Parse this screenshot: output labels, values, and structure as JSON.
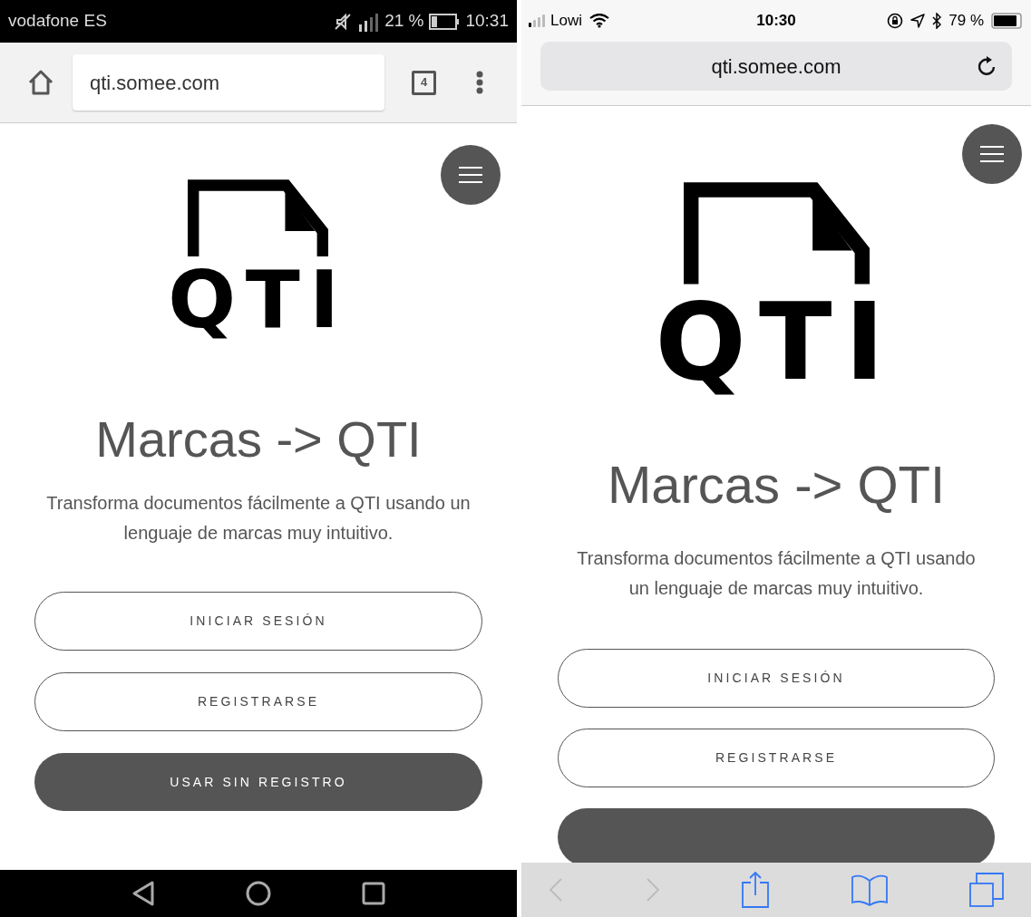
{
  "phones": [
    {
      "kind": "android",
      "status_bar": {
        "carrier": "vodafone ES",
        "battery": "21 %",
        "time": "10:31"
      },
      "address_bar": {
        "url": "qti.somee.com",
        "tab_count": "4"
      },
      "page": {
        "logo_text": "QTI",
        "title": "Marcas -> QTI",
        "description": "Transforma documentos fácilmente a QTI usando un lenguaje de marcas muy intuitivo."
      },
      "buttons": [
        {
          "kind": "outline",
          "label": "INICIAR SESIÓN"
        },
        {
          "kind": "outline",
          "label": "REGISTRARSE"
        },
        {
          "kind": "filled",
          "label": "USAR SIN REGISTRO"
        }
      ]
    },
    {
      "kind": "ios",
      "status_bar": {
        "carrier": "Lowi",
        "time": "10:30",
        "battery": "79 %"
      },
      "address_bar": {
        "url": "qti.somee.com"
      },
      "page": {
        "logo_text": "QTI",
        "title": "Marcas -> QTI",
        "description": "Transforma documentos fácilmente a QTI usando un lenguaje de marcas muy intuitivo."
      },
      "buttons": [
        {
          "kind": "outline",
          "label": "INICIAR SESIÓN"
        },
        {
          "kind": "outline",
          "label": "REGISTRARSE"
        },
        {
          "kind": "filled"
        }
      ]
    }
  ]
}
